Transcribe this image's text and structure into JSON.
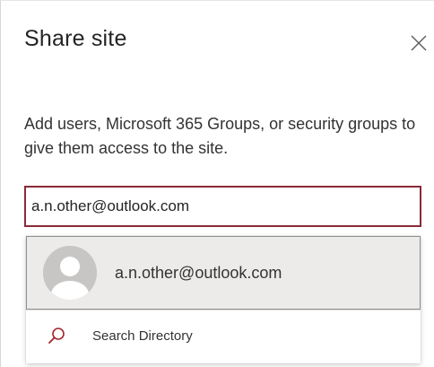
{
  "panel": {
    "title": "Share site",
    "description": "Add users, Microsoft 365 Groups, or security groups to give them access to the site."
  },
  "input": {
    "value": "a.n.other@outlook.com"
  },
  "dropdown": {
    "suggestion_label": "a.n.other@outlook.com",
    "search_directory_label": "Search Directory"
  },
  "colors": {
    "input_border": "#8a2a37",
    "search_icon": "#a4262c",
    "suggestion_bg": "#edebe9"
  },
  "icons": {
    "close": "close-icon",
    "avatar": "person-avatar-icon",
    "search": "search-icon"
  }
}
